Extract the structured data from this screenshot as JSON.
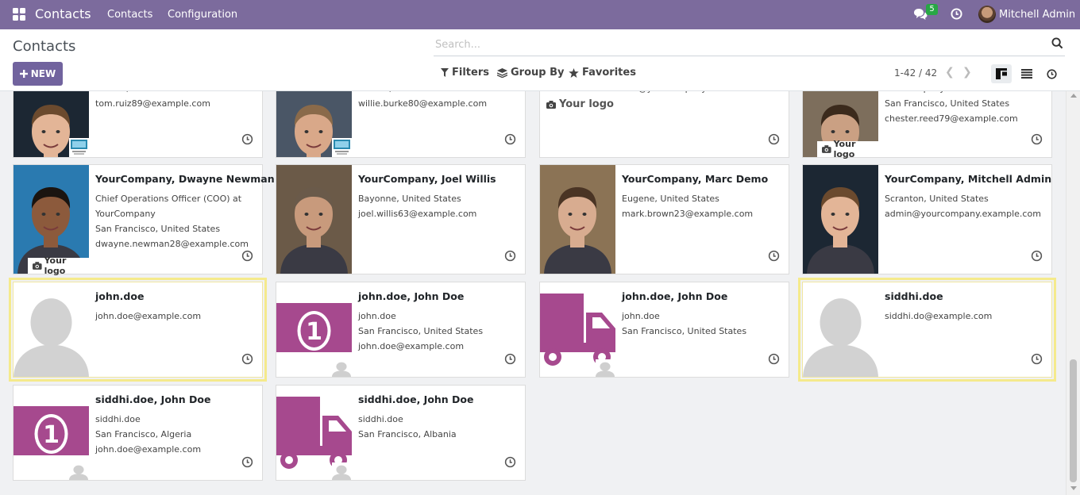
{
  "navbar": {
    "app_title": "Contacts",
    "menu": [
      "Contacts",
      "Configuration"
    ],
    "chat_count": "5",
    "user_name": "Mitchell Admin",
    "color": "#7c6b9d"
  },
  "control_panel": {
    "title": "Contacts",
    "new_label": "NEW",
    "search_placeholder": "Search...",
    "filters_label": "Filters",
    "group_by_label": "Group By",
    "favorites_label": "Favorites",
    "pager": "1-42 / 42"
  },
  "cards": [
    {
      "title": "",
      "lines": [
        "Turlock, United States",
        "tom.ruiz89@example.com"
      ],
      "image": "photo-man-1",
      "overlay": "company-thumb"
    },
    {
      "title": "",
      "lines": [
        "Turlock, United States",
        "willie.burke80@example.com"
      ],
      "image": "photo-man-2",
      "overlay": "company-thumb"
    },
    {
      "title": "",
      "lines": [
        "info@yourcompany.com"
      ],
      "image": "your-logo",
      "overlay": "none"
    },
    {
      "title": "",
      "lines": [
        "YourCompany",
        "San Francisco, United States",
        "chester.reed79@example.com"
      ],
      "image": "photo-man-3",
      "overlay": "your-logo"
    },
    {
      "title": "YourCompany, Dwayne Newman",
      "lines": [
        "Chief Operations Officer (COO) at",
        "YourCompany",
        "San Francisco, United States",
        "dwayne.newman28@example.com"
      ],
      "image": "photo-man-4",
      "overlay": "your-logo"
    },
    {
      "title": "YourCompany, Joel Willis",
      "lines": [
        "Bayonne, United States",
        "joel.willis63@example.com"
      ],
      "image": "photo-man-5",
      "overlay": "none"
    },
    {
      "title": "YourCompany, Marc Demo",
      "lines": [
        "Eugene, United States",
        "mark.brown23@example.com"
      ],
      "image": "photo-man-6",
      "overlay": "none"
    },
    {
      "title": "YourCompany, Mitchell Admin",
      "lines": [
        "Scranton, United States",
        "admin@yourcompany.example.com"
      ],
      "image": "photo-man-7",
      "overlay": "none"
    },
    {
      "title": "john.doe",
      "lines": [
        "john.doe@example.com"
      ],
      "image": "placeholder-person",
      "overlay": "none",
      "selected": true
    },
    {
      "title": "john.doe, John Doe",
      "lines": [
        "john.doe",
        "San Francisco, United States",
        "john.doe@example.com"
      ],
      "image": "money-icon",
      "overlay": "mini-person"
    },
    {
      "title": "john.doe, John Doe",
      "lines": [
        "john.doe",
        "San Francisco, United States"
      ],
      "image": "truck-icon",
      "overlay": "mini-person"
    },
    {
      "title": "siddhi.doe",
      "lines": [
        "siddhi.do@example.com"
      ],
      "image": "placeholder-person",
      "overlay": "none",
      "selected": true
    },
    {
      "title": "siddhi.doe, John Doe",
      "lines": [
        "siddhi.doe",
        "San Francisco, Algeria",
        "john.doe@example.com"
      ],
      "image": "money-icon",
      "overlay": "mini-person"
    },
    {
      "title": "siddhi.doe, John Doe",
      "lines": [
        "siddhi.doe",
        "San Francisco, Albania"
      ],
      "image": "truck-icon",
      "overlay": "mini-person"
    }
  ],
  "your_logo_text": "Your logo",
  "accent_purple": "#a6498e"
}
